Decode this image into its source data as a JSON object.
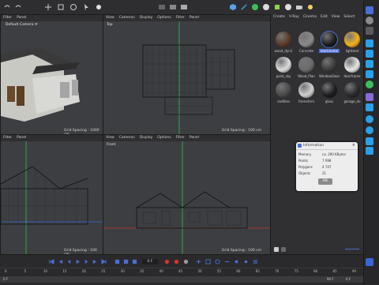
{
  "colors": {
    "accent": "#4a6fd4",
    "viewport_bg": "#3d3e42",
    "axis_green": "#2fbf4a",
    "axis_red": "#c8322c",
    "axis_blue": "#3a64d8",
    "record": "#e0302c",
    "gold": "#f2b21c"
  },
  "viewport_tl": {
    "menu": [
      "Filter",
      "Panel"
    ],
    "camera": "Default Camera ⟳",
    "grid": "Grid Spacing : 1000 cm"
  },
  "viewport_tr": {
    "menu": [
      "View",
      "Cameras",
      "Display",
      "Options",
      "Filter",
      "Panel"
    ],
    "title": "Top",
    "grid": "Grid Spacing : 100 cm"
  },
  "viewport_bl": {
    "menu": [
      "Filter",
      "Panel"
    ],
    "grid": "Grid Spacing : 100 cm"
  },
  "viewport_br": {
    "menu": [
      "View",
      "Cameras",
      "Display",
      "Options",
      "Filter",
      "Panel"
    ],
    "title": "Front",
    "grid": "Grid Spacing : 100 cm"
  },
  "material_manager": {
    "menu": [
      "Create",
      "V-Ray",
      "Cinema",
      "Edit",
      "View",
      "Select"
    ],
    "materials": [
      {
        "name": "wood_dyn1",
        "color": "#5b3b28"
      },
      {
        "name": "Concrete",
        "color": "#8a8a8a"
      },
      {
        "name": "blackmetal",
        "color": "#1c1c1c",
        "selected": true
      },
      {
        "name": "lightmat",
        "color": "#f2b21c"
      },
      {
        "name": "paint_sky",
        "color": "#dcdcdc"
      },
      {
        "name": "Wood_Plan",
        "color": "#6b6b6b"
      },
      {
        "name": "WindowGlass",
        "color": "#3a3a3a"
      },
      {
        "name": "doorframe",
        "color": "#e6e6e6"
      },
      {
        "name": "rooftiles",
        "color": "#4a4a4a"
      },
      {
        "name": "frametrim",
        "color": "#cfcfcf"
      },
      {
        "name": "glass",
        "color": "#1e1e22"
      },
      {
        "name": "garage_do",
        "color": "#2a2a2a"
      }
    ]
  },
  "info_dialog": {
    "title": "Information",
    "rows": [
      {
        "label": "Memory",
        "value": "ca. 200 KBytes"
      },
      {
        "label": "Points",
        "value": "7 098"
      },
      {
        "label": "Polygons",
        "value": "4 747"
      },
      {
        "label": "Objects",
        "value": "21"
      }
    ],
    "ok": "OK"
  },
  "timeline": {
    "frame": "0 F",
    "ruler": [
      "0",
      "5",
      "10",
      "15",
      "20",
      "25",
      "30",
      "35",
      "40",
      "45",
      "50",
      "55",
      "60",
      "65",
      "70",
      "75",
      "80",
      "85",
      "90"
    ],
    "start": "0 F",
    "end": "90 F",
    "cur": "0 F"
  }
}
